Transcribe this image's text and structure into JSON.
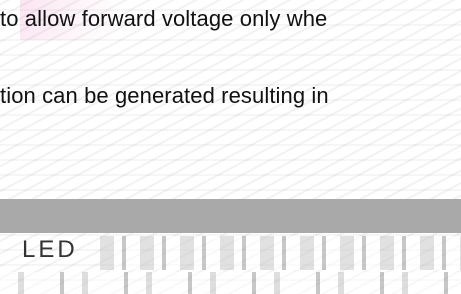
{
  "content": {
    "line_1": "to allow forward voltage only whe",
    "line_2": "tion can be generated resulting in",
    "section_label": "LED"
  },
  "colors": {
    "text": "#111111",
    "bar": "#a9a9a9",
    "background": "#ffffff"
  }
}
